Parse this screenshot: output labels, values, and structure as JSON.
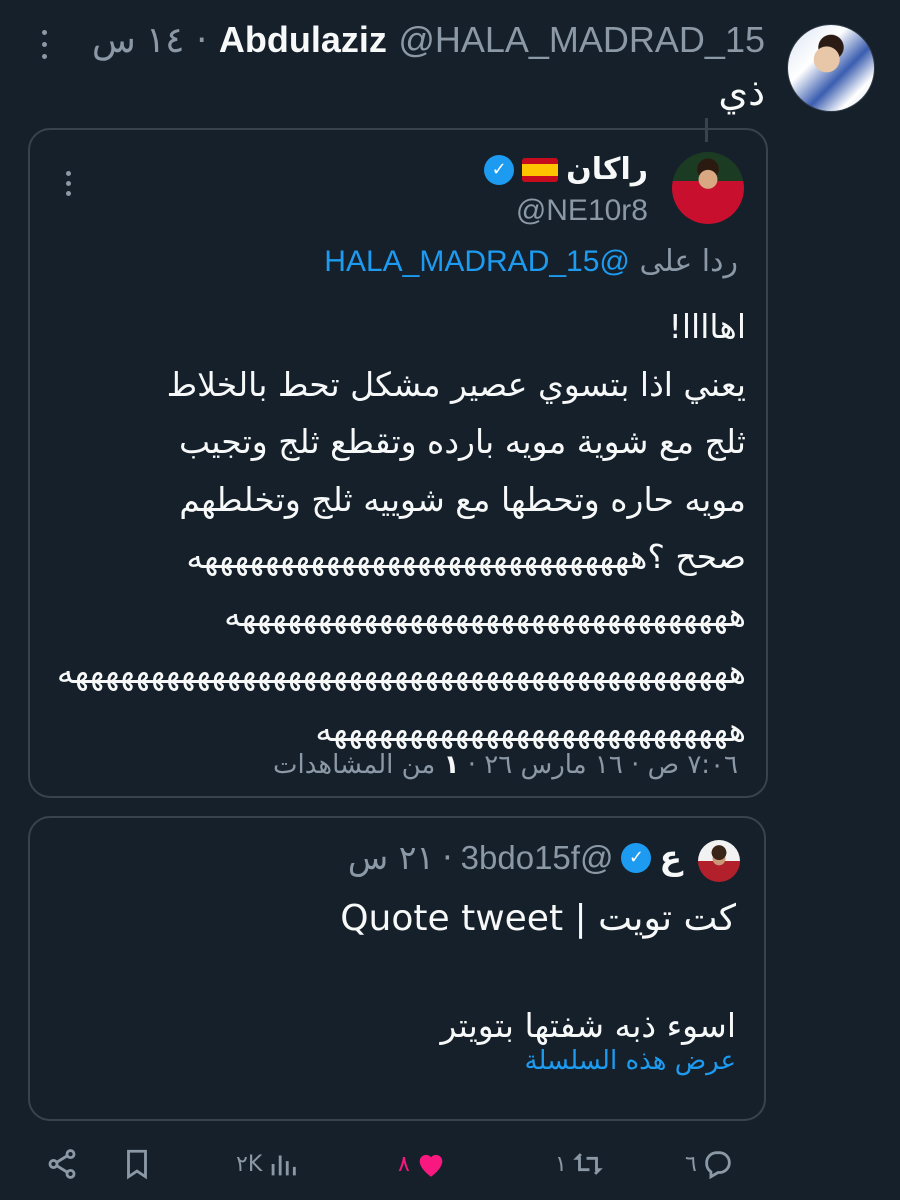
{
  "tweet": {
    "author_name": "Abdulaziz",
    "handle": "@HALA_MADRAD_15",
    "time": "١٤ س",
    "separator": "·",
    "text": "ذي"
  },
  "quoted_tweet": {
    "author_name": "راكان",
    "flag": "Spain flag",
    "verified": true,
    "handle": "@NE10r8",
    "reply_prefix": "ردا على",
    "reply_mention": "@HALA_MADRAD_15",
    "lines": [
      "اهاااا!",
      "يعني اذا بتسوي عصير مشكل تحط بالخلاط",
      "ثلج مع شوية مويه بارده وتقطع ثلج وتجيب",
      "مويه حاره وتحطها مع شوييه ثلج وتخلطهم",
      "صحح ؟هههههههههههههههههههههههههههههه",
      "هههههههههههههههههههههههههههههههههه",
      "ههههههههههههههههههههههههههههههههههههههههههههه",
      "هههههههههههههههههههههههههههه"
    ],
    "meta_time": "٧:٠٦ ص",
    "meta_date": "١٦ مارس ٢٦",
    "meta_views_count": "١",
    "meta_views_label": "من المشاهدات"
  },
  "nested_quote": {
    "author_name": "ع",
    "verified": true,
    "handle": "@3bdo15f",
    "time": "٢١ س",
    "line1": "كت تويت | Quote tweet",
    "line2": "اسوء ذبه شفتها بتويتر",
    "show_thread": "عرض هذه السلسلة"
  },
  "actions": {
    "replies": "٦",
    "retweets": "١",
    "likes": "٨",
    "views": "٢K"
  },
  "colors": {
    "background": "#15202b",
    "accent": "#1d9bf0",
    "like": "#f91880",
    "muted": "#8b98a5",
    "border": "#38444d"
  }
}
